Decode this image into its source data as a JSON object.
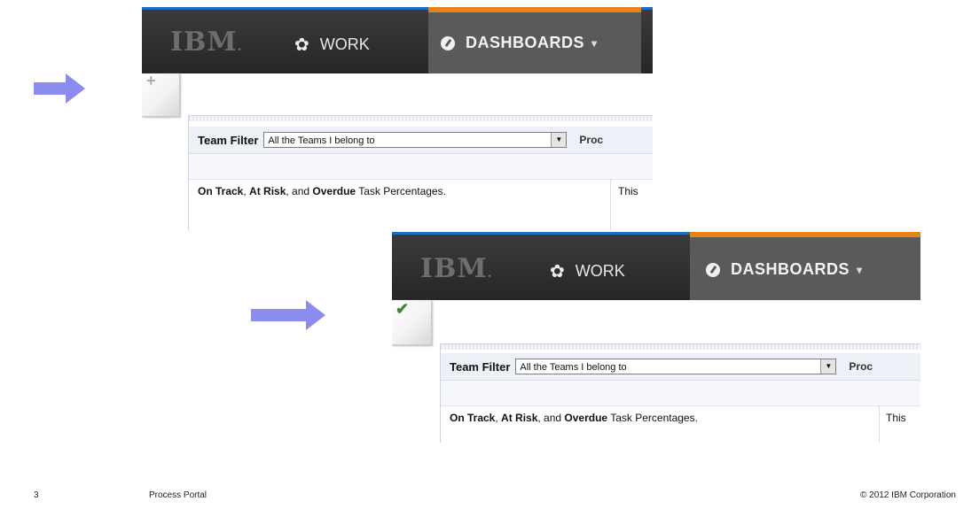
{
  "brand": {
    "logo_text": "IBM",
    "logo_dot": "."
  },
  "nav": {
    "work_label": "WORK",
    "dashboards_label": "DASHBOARDS",
    "caret": "▾",
    "gear_glyph": "✿"
  },
  "corner_icons": {
    "first": "+",
    "second": "✔"
  },
  "dashboard": {
    "team_filter_label": "Team Filter",
    "team_filter_value": "All the Teams I belong to",
    "dropdown_glyph": "▼",
    "proc_heading_partial": "Proc",
    "task_pct_parts": [
      "On Track",
      ", ",
      "At Risk",
      ", and ",
      "Overdue",
      " Task Percentages."
    ],
    "right_cell_partial": "This"
  },
  "footer": {
    "slide_number": "3",
    "title": "Process Portal",
    "copyright": "© 2012 IBM Corporation"
  },
  "colors": {
    "accent_blue": "#1f6fc0",
    "accent_orange": "#e8821a",
    "arrow": "#8c8cf0",
    "check_green": "#3a8a2a"
  }
}
